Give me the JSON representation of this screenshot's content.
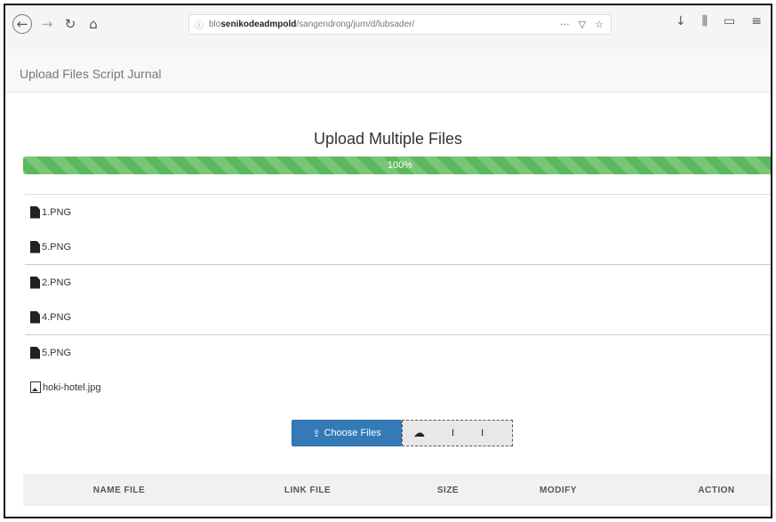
{
  "browser": {
    "url_prefix": "blo",
    "url_host": "senikodeadmpold",
    "url_path": "/sangendrong/jurn/d/lubsader/",
    "url_menu": "···",
    "icons": {
      "back": "back-arrow-icon",
      "forward": "forward-arrow-icon",
      "reload": "reload-icon",
      "home": "home-icon",
      "lock": "lock-icon",
      "pocket": "pocket-icon",
      "bookmark": "star-icon",
      "download": "download-icon",
      "library": "library-icon",
      "sidebar": "sidebar-icon",
      "menu": "hamburger-menu-icon"
    }
  },
  "bookmark": {
    "label": "Upload Files Script Jurnal"
  },
  "page": {
    "title": "Upload Multiple Files"
  },
  "progress": {
    "value": 100,
    "label": "100%",
    "color": "#5cb85c"
  },
  "files": {
    "groups": [
      [
        {
          "name": "1.PNG",
          "icon": "file-icon"
        },
        {
          "name": "5.PNG",
          "icon": "file-icon"
        }
      ],
      [
        {
          "name": "2.PNG",
          "icon": "file-icon"
        },
        {
          "name": "4.PNG",
          "icon": "file-icon"
        }
      ],
      [
        {
          "name": "5.PNG",
          "icon": "file-icon"
        },
        {
          "name": "hoki-hotel.jpg",
          "icon": "image-icon"
        }
      ]
    ]
  },
  "buttons": {
    "choose": "Choose Files",
    "choose_color": "#337ab7",
    "upload_marks": [
      "I",
      "I"
    ]
  },
  "table": {
    "headers": [
      "NAME FILE",
      "LINK FILE",
      "SIZE",
      "MODIFY",
      "ACTION"
    ]
  }
}
